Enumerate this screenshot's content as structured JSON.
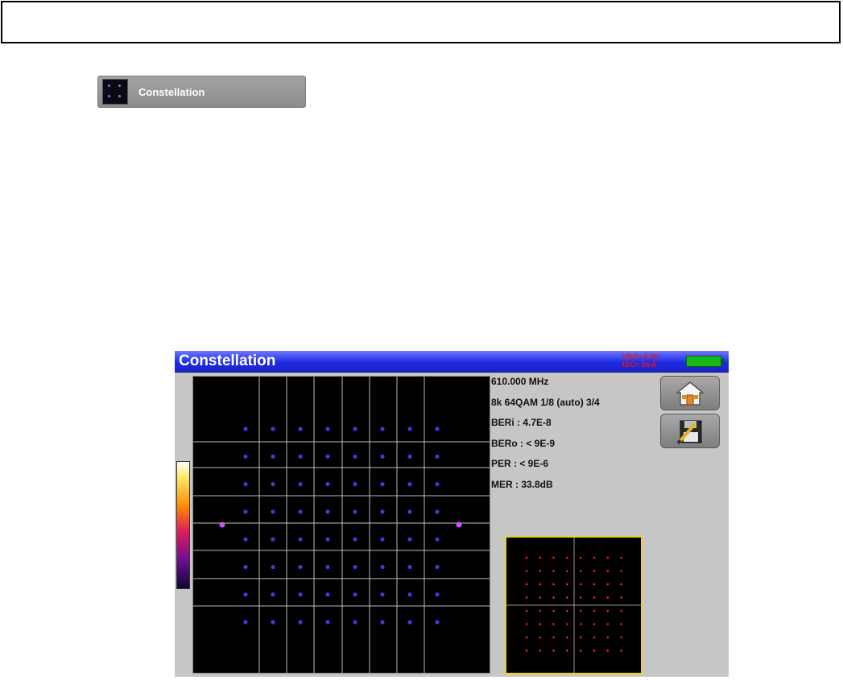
{
  "menu": {
    "label": "Constellation",
    "icon": "constellation-icon"
  },
  "device": {
    "title": "Constellation",
    "vdc": "VDC= 0.0V",
    "idc": "IDC=  0mA",
    "battery_icon": "battery-icon",
    "info": [
      "610.000 MHz",
      "8k 64QAM 1/8 (auto) 3/4",
      "BERi : 4.7E-8",
      "BERo : < 9E-9",
      "PER  : < 9E-6",
      "MER  :  33.8dB"
    ],
    "buttons": {
      "home_icon": "home-icon",
      "save_icon": "save-edit-icon"
    },
    "constellation": {
      "modulation": "64QAM",
      "grid_size": 8,
      "point_color": "#5a3cff",
      "pilot_color": "#d050ff",
      "reference_point_color": "#ff2020",
      "reference_frame_color": "#f2d21a"
    }
  }
}
